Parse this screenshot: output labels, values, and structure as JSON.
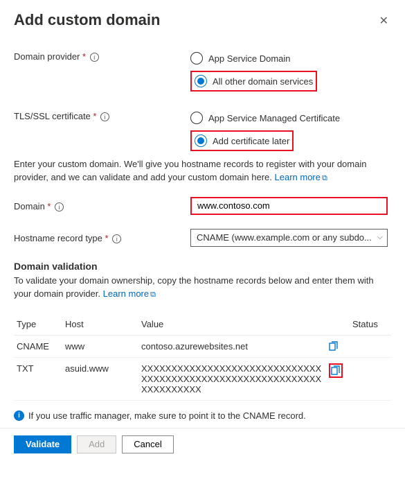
{
  "title": "Add custom domain",
  "labels": {
    "domain_provider": "Domain provider",
    "tls_cert": "TLS/SSL certificate",
    "domain": "Domain",
    "hostname_record_type": "Hostname record type"
  },
  "radios": {
    "provider_opt1": "App Service Domain",
    "provider_opt2": "All other domain services",
    "cert_opt1": "App Service Managed Certificate",
    "cert_opt2": "Add certificate later"
  },
  "intro_text": "Enter your custom domain. We'll give you hostname records to register with your domain provider, and we can validate and add your custom domain here. ",
  "learn_more": "Learn more",
  "domain_value": "www.contoso.com",
  "hostname_select": "CNAME (www.example.com or any subdo...",
  "validation": {
    "title": "Domain validation",
    "desc": "To validate your domain ownership, copy the hostname records below and enter them with your domain provider. "
  },
  "table": {
    "headers": {
      "type": "Type",
      "host": "Host",
      "value": "Value",
      "status": "Status"
    },
    "rows": [
      {
        "type": "CNAME",
        "host": "www",
        "value": "contoso.azurewebsites.net",
        "copy_highlight": false
      },
      {
        "type": "TXT",
        "host": "asuid.www",
        "value": "XXXXXXXXXXXXXXXXXXXXXXXXXXXXXXXXXXXXXXXXXXXXXXXXXXXXXXXXXXXXXXXXXXXXXX",
        "copy_highlight": true
      }
    ]
  },
  "info_note": "If you use traffic manager, make sure to point it to the CNAME record.",
  "buttons": {
    "validate": "Validate",
    "add": "Add",
    "cancel": "Cancel"
  }
}
